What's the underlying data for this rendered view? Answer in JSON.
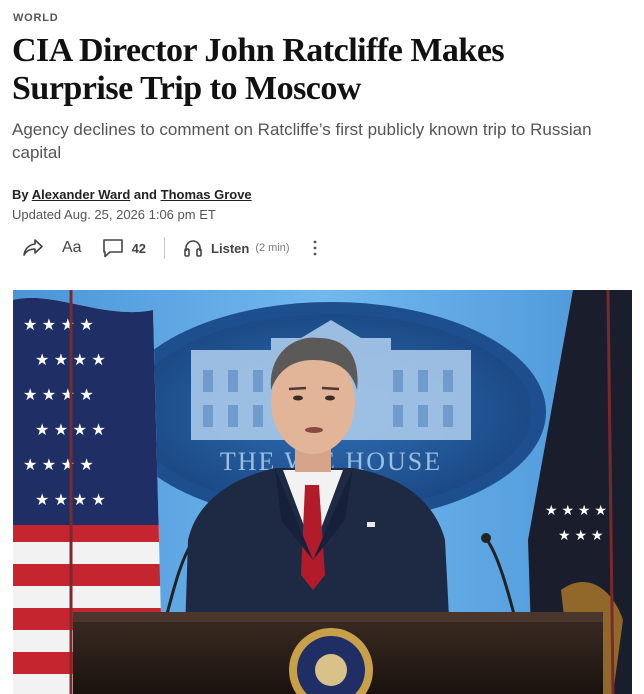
{
  "section_label": "WORLD",
  "headline": "CIA Director John Ratcliffe Makes Surprise Trip to Moscow",
  "dek": "Agency declines to comment on Ratcliffe’s first publicly known trip to Russian capital",
  "byline": {
    "prefix": "By",
    "author1": "Alexander Ward",
    "joiner": "and",
    "author2": "Thomas Grove"
  },
  "updated": "Updated Aug. 25, 2026 1:06 pm ET",
  "toolbar": {
    "share_icon": "share-arrow-icon",
    "text_size_label": "Aa",
    "comments_icon": "comment-bubble-icon",
    "comments_count": "42",
    "listen_icon": "headphones-icon",
    "listen_label": "Listen",
    "listen_duration": "(2 min)",
    "more_icon": "vertical-ellipsis-icon"
  },
  "photo": {
    "background_text": "THE W   E HOUSE"
  },
  "colors": {
    "headline": "#111111",
    "dek": "#555555",
    "photo_bg": "#5aa6e6",
    "suit": "#1e2a44",
    "tie": "#b31b2a"
  }
}
